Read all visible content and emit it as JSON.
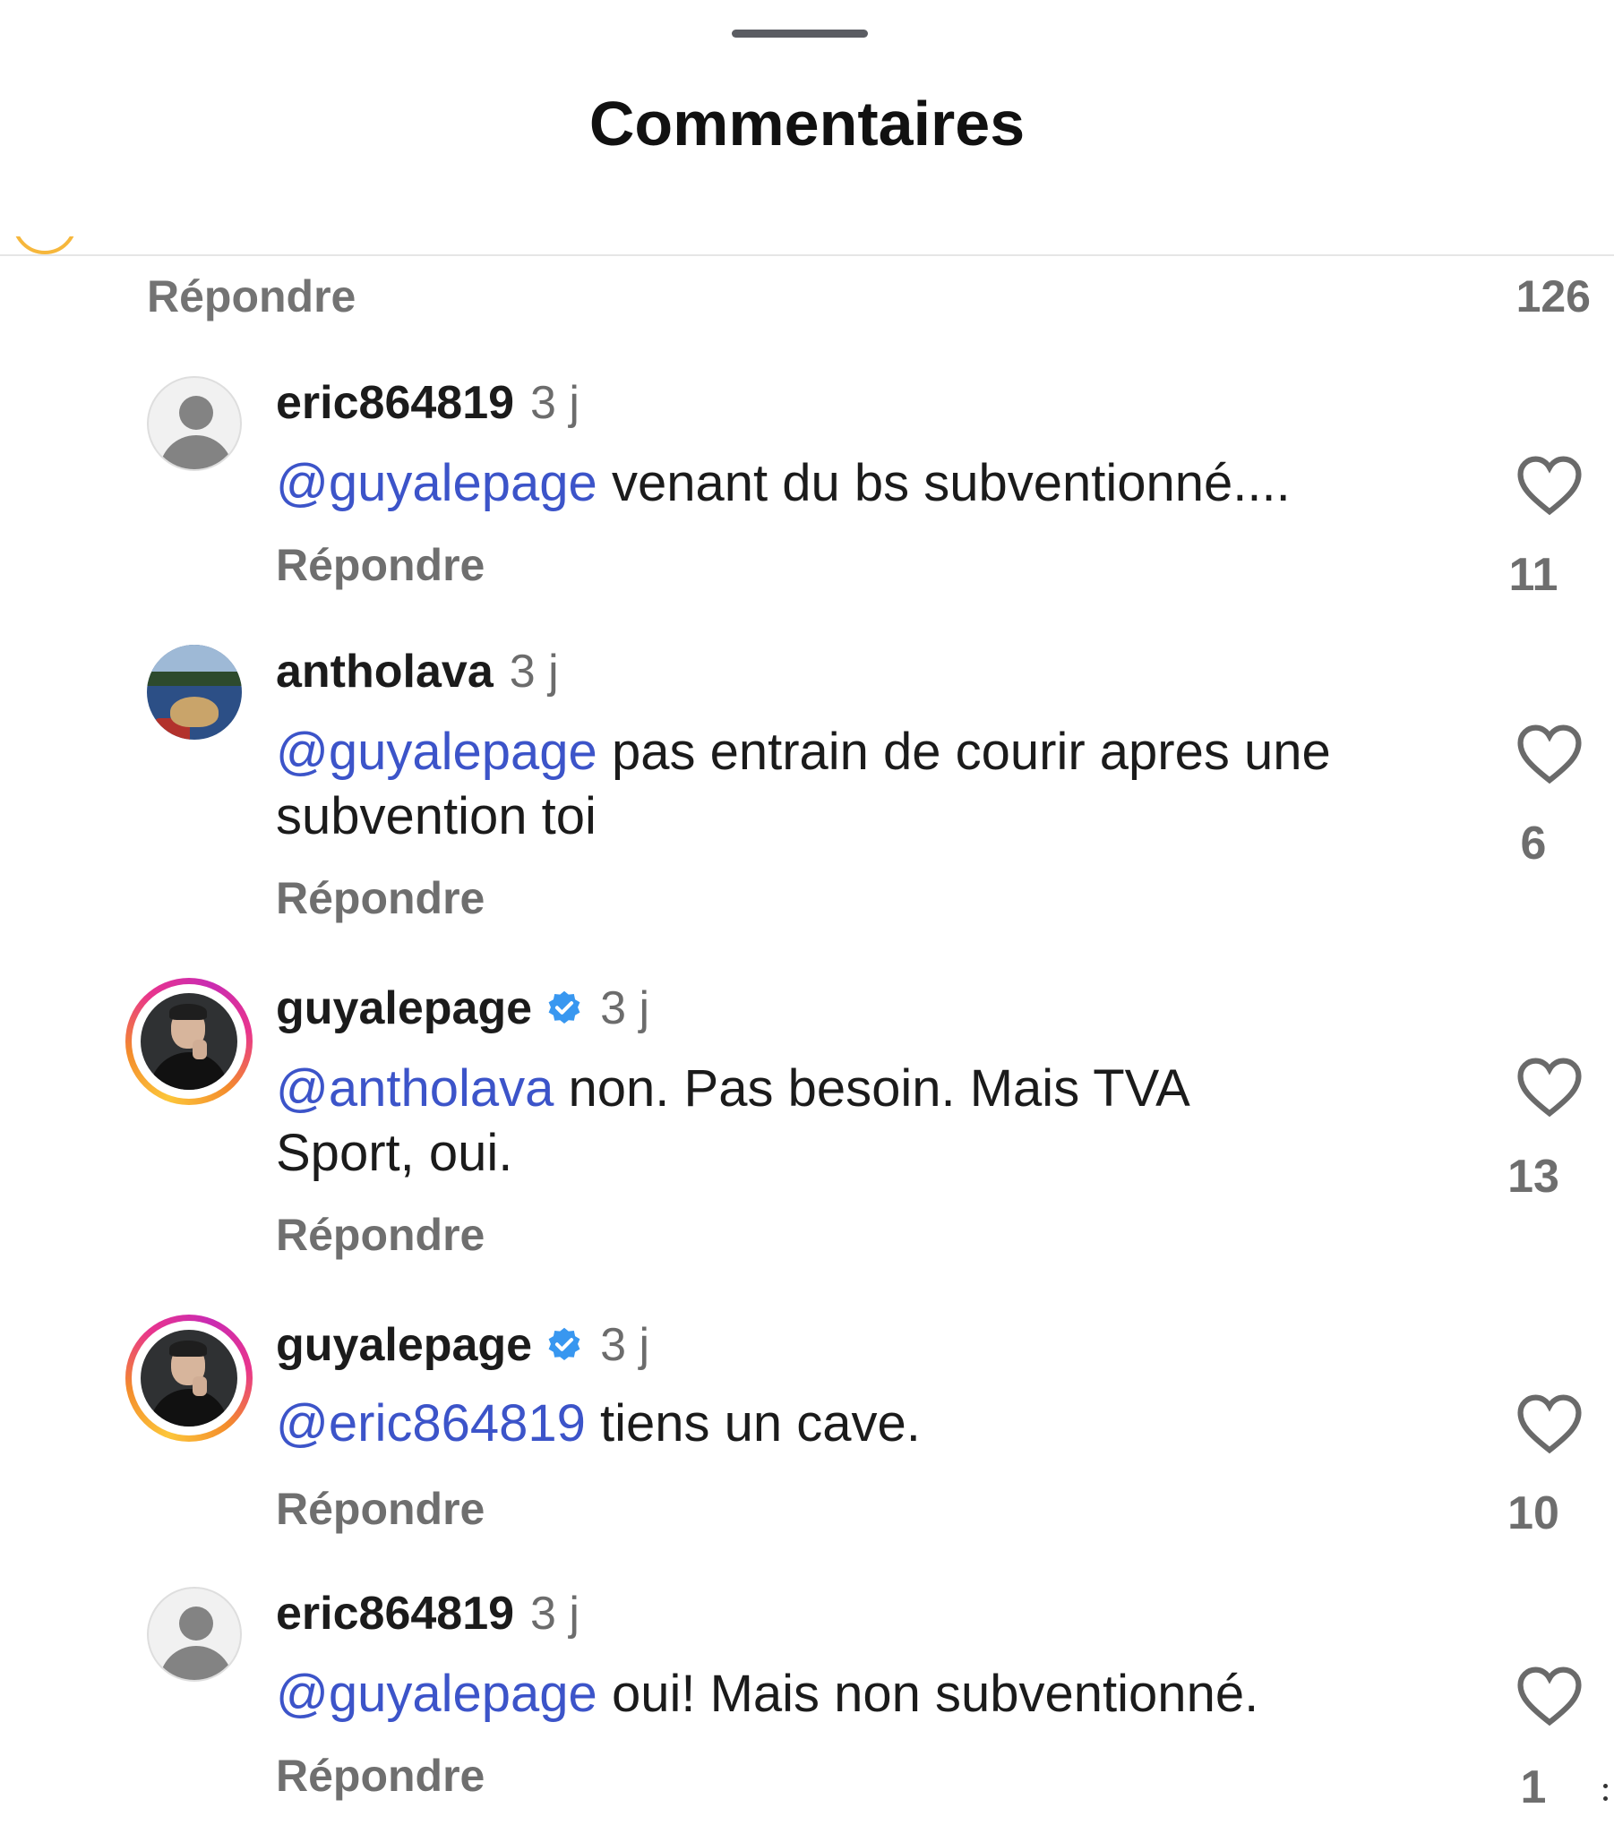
{
  "sheet": {
    "title": "Commentaires"
  },
  "previous": {
    "reply_label": "Répondre",
    "likes": "126"
  },
  "comments": [
    {
      "username": "eric864819",
      "verified": false,
      "time": "3 j",
      "mention": "@guyalepage",
      "text": " venant du bs subventionné....",
      "reply_label": "Répondre",
      "likes": "11"
    },
    {
      "username": "antholava",
      "verified": false,
      "time": "3 j",
      "mention": "@guyalepage",
      "text": " pas entrain de courir apres une subvention toi",
      "reply_label": "Répondre",
      "likes": "6"
    },
    {
      "username": "guyalepage",
      "verified": true,
      "time": "3 j",
      "mention": "@antholava",
      "text": " non. Pas besoin. Mais TVA Sport, oui.",
      "reply_label": "Répondre",
      "likes": "13"
    },
    {
      "username": "guyalepage",
      "verified": true,
      "time": "3 j",
      "mention": "@eric864819",
      "text": " tiens un cave.",
      "reply_label": "Répondre",
      "likes": "10"
    },
    {
      "username": "eric864819",
      "verified": false,
      "time": "3 j",
      "mention": "@guyalepage",
      "text": " oui! Mais non subventionné.",
      "reply_label": "Répondre",
      "likes": "1"
    }
  ],
  "colors": {
    "mention": "#3c54c9",
    "verified": "#3897f0",
    "secondary_text": "#6f6f6f"
  }
}
